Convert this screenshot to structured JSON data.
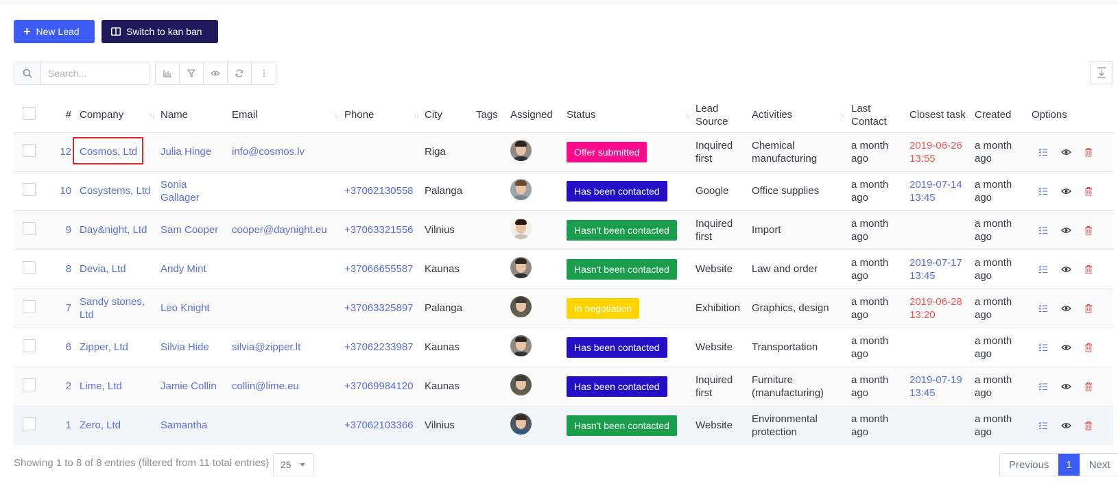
{
  "toolbar": {
    "new_lead_label": "New Lead",
    "kanban_label": "Switch to kan ban",
    "search_placeholder": "Search..."
  },
  "table": {
    "headers": {
      "num": "#",
      "company": "Company",
      "name": "Name",
      "email": "Email",
      "phone": "Phone",
      "city": "City",
      "tags": "Tags",
      "assigned": "Assigned",
      "status": "Status",
      "lead_source": "Lead Source",
      "activities": "Activities",
      "last_contact": "Last Contact",
      "closest_task": "Closest task",
      "created": "Created",
      "options": "Options"
    },
    "rows": [
      {
        "num": "12",
        "company": "Cosmos, Ltd",
        "name": "Julia Hinge",
        "email": "info@cosmos.lv",
        "phone": "",
        "city": "Riga",
        "status": "Offer submitted",
        "status_color": "#ff0a8c",
        "source": "Inquired first",
        "activities": "Chemical manufacturing",
        "last_contact": "a month ago",
        "task": "2019-06-26 13:55",
        "task_overdue": true,
        "created": "a month ago"
      },
      {
        "num": "10",
        "company": "Cosystems, Ltd",
        "name": "Sonia Gallager",
        "email": "",
        "phone": "+37062130558",
        "city": "Palanga",
        "status": "Has been contacted",
        "status_color": "#2310c6",
        "source": "Google",
        "activities": "Office supplies",
        "last_contact": "a month ago",
        "task": "2019-07-14 13:45",
        "task_overdue": false,
        "created": "a month ago"
      },
      {
        "num": "9",
        "company": "Day&night, Ltd",
        "name": "Sam Cooper",
        "email": "cooper@daynight.eu",
        "phone": "+37063321556",
        "city": "Vilnius",
        "status": "Hasn't been contacted",
        "status_color": "#1a9e4b",
        "source": "Inquired first",
        "activities": "Import",
        "last_contact": "a month ago",
        "task": "",
        "task_overdue": false,
        "created": "a month ago"
      },
      {
        "num": "8",
        "company": "Devia, Ltd",
        "name": "Andy Mint",
        "email": "",
        "phone": "+37066655587",
        "city": "Kaunas",
        "status": "Hasn't been contacted",
        "status_color": "#1a9e4b",
        "source": "Website",
        "activities": "Law and order",
        "last_contact": "a month ago",
        "task": "2019-07-17 13:45",
        "task_overdue": false,
        "created": "a month ago"
      },
      {
        "num": "7",
        "company": "Sandy stones, Ltd",
        "name": "Leo Knight",
        "email": "",
        "phone": "+37063325897",
        "city": "Palanga",
        "status": "In negotiation",
        "status_color": "#ffd400",
        "source": "Exhibition",
        "activities": "Graphics, design",
        "last_contact": "a month ago",
        "task": "2019-06-28 13:20",
        "task_overdue": true,
        "created": "a month ago"
      },
      {
        "num": "6",
        "company": "Zipper, Ltd",
        "name": "Silvia Hide",
        "email": "silvia@zipper.lt",
        "phone": "+37062233987",
        "city": "Kaunas",
        "status": "Has been contacted",
        "status_color": "#2310c6",
        "source": "Website",
        "activities": "Transportation",
        "last_contact": "a month ago",
        "task": "",
        "task_overdue": false,
        "created": "a month ago"
      },
      {
        "num": "2",
        "company": "Lime, Ltd",
        "name": "Jamie Collin",
        "email": "collin@lime.eu",
        "phone": "+37069984120",
        "city": "Kaunas",
        "status": "Has been contacted",
        "status_color": "#2310c6",
        "source": "Inquired first",
        "activities": "Furniture (manufacturing)",
        "last_contact": "a month ago",
        "task": "2019-07-19 13:45",
        "task_overdue": false,
        "created": "a month ago"
      },
      {
        "num": "1",
        "company": "Zero, Ltd",
        "name": "Samantha",
        "email": "",
        "phone": "+37062103366",
        "city": "Vilnius",
        "status": "Hasn't been contacted",
        "status_color": "#1a9e4b",
        "source": "Website",
        "activities": "Environmental protection",
        "last_contact": "a month ago",
        "task": "",
        "task_overdue": false,
        "created": "a month ago"
      }
    ]
  },
  "footer": {
    "info": "Showing 1 to 8 of 8 entries (filtered from 11 total entries)",
    "page_length": "25",
    "prev_label": "Previous",
    "current_page": "1",
    "next_label": "Next"
  },
  "colors": {
    "accent": "#3d5cf3",
    "dark_button": "#1d1b5c",
    "link": "#5a6fe0",
    "overdue": "#f0564f",
    "delete": "#f0564f",
    "highlight_box": "#e0262e"
  },
  "icons": {
    "new_lead": "plus-icon",
    "kanban": "columns-icon",
    "search": "search-icon",
    "tools": [
      "bar-chart-icon",
      "filter-icon",
      "eye-icon",
      "refresh-icon",
      "more-vertical-icon"
    ],
    "export": "download-icon",
    "row_options": [
      "task-list-icon",
      "view-eye-icon",
      "trash-icon"
    ]
  }
}
